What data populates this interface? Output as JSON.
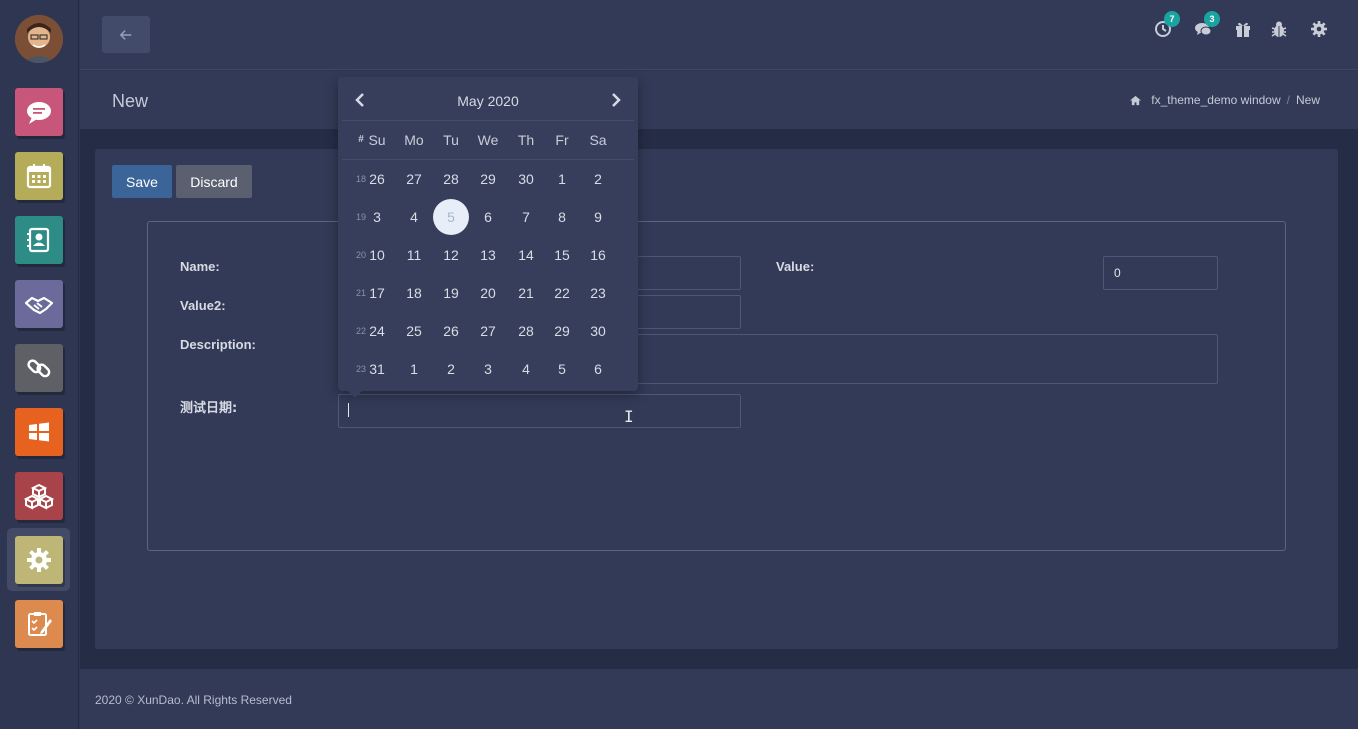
{
  "header": {
    "back_icon": "arrow-left-icon",
    "activity_badge": "7",
    "messages_badge": "3"
  },
  "control": {
    "page_title": "New",
    "breadcrumb": [
      "fx_theme_demo window",
      "New"
    ],
    "separator": "/"
  },
  "form": {
    "save_label": "Save",
    "discard_label": "Discard",
    "name_label": "Name:",
    "value_label": "Value:",
    "value_input": "0",
    "value2_label": "Value2:",
    "description_label": "Description:",
    "date_label": "测试日期:",
    "date_value": ""
  },
  "datepicker": {
    "title": "May 2020",
    "week_header": "#",
    "days_of_week": [
      "Su",
      "Mo",
      "Tu",
      "We",
      "Th",
      "Fr",
      "Sa"
    ],
    "weeks": [
      {
        "num": "18",
        "days": [
          "26",
          "27",
          "28",
          "29",
          "30",
          "1",
          "2"
        ]
      },
      {
        "num": "19",
        "days": [
          "3",
          "4",
          "5",
          "6",
          "7",
          "8",
          "9"
        ]
      },
      {
        "num": "20",
        "days": [
          "10",
          "11",
          "12",
          "13",
          "14",
          "15",
          "16"
        ]
      },
      {
        "num": "21",
        "days": [
          "17",
          "18",
          "19",
          "20",
          "21",
          "22",
          "23"
        ]
      },
      {
        "num": "22",
        "days": [
          "24",
          "25",
          "26",
          "27",
          "28",
          "29",
          "30"
        ]
      },
      {
        "num": "23",
        "days": [
          "31",
          "1",
          "2",
          "3",
          "4",
          "5",
          "6"
        ]
      }
    ],
    "today": "5"
  },
  "footer": {
    "text": "2020 © XunDao. All Rights Reserved"
  },
  "colors": {
    "save": "#3b6499",
    "discard": "#5a6070",
    "badge": "#1aa3a0",
    "app_discuss": "#c8557a",
    "app_calendar": "#b5ac5a",
    "app_contacts": "#2e8c86",
    "app_crm": "#6b6a9a",
    "app_link": "#5e6066",
    "app_windows": "#e8621f",
    "app_inventory": "#a8434a",
    "app_settings": "#bdb676",
    "app_survey": "#dd8a4f"
  }
}
